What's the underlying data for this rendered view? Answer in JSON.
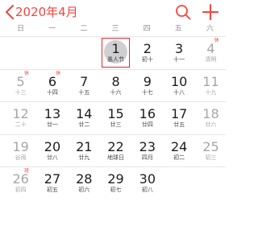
{
  "header": {
    "back_label": "2020年4月",
    "accent_color": "#f2453d",
    "icons": [
      "chevron-left-icon",
      "search-icon",
      "plus-icon"
    ]
  },
  "weekdays": [
    "日",
    "一",
    "二",
    "三",
    "四",
    "五",
    "六"
  ],
  "weeks": [
    [
      {
        "day": "",
        "sub": ""
      },
      {
        "day": "",
        "sub": ""
      },
      {
        "day": "",
        "sub": ""
      },
      {
        "day": "1",
        "sub": "愚人节",
        "today": true
      },
      {
        "day": "2",
        "sub": "初十"
      },
      {
        "day": "3",
        "sub": "十一"
      },
      {
        "day": "4",
        "sub": "清明",
        "badge": "休"
      }
    ],
    [
      {
        "day": "5",
        "sub": "十三",
        "badge": "休"
      },
      {
        "day": "6",
        "sub": "十四",
        "badge": "休"
      },
      {
        "day": "7",
        "sub": "十五"
      },
      {
        "day": "8",
        "sub": "十六"
      },
      {
        "day": "9",
        "sub": "十七"
      },
      {
        "day": "10",
        "sub": "十八"
      },
      {
        "day": "11",
        "sub": "十九"
      }
    ],
    [
      {
        "day": "12",
        "sub": "二十"
      },
      {
        "day": "13",
        "sub": "廿一"
      },
      {
        "day": "14",
        "sub": "廿二"
      },
      {
        "day": "15",
        "sub": "廿三"
      },
      {
        "day": "16",
        "sub": "廿四"
      },
      {
        "day": "17",
        "sub": "廿五"
      },
      {
        "day": "18",
        "sub": "廿六"
      }
    ],
    [
      {
        "day": "19",
        "sub": "谷雨"
      },
      {
        "day": "20",
        "sub": "廿八"
      },
      {
        "day": "21",
        "sub": "廿九"
      },
      {
        "day": "22",
        "sub": "地球日"
      },
      {
        "day": "23",
        "sub": "四月"
      },
      {
        "day": "24",
        "sub": "初二"
      },
      {
        "day": "25",
        "sub": "初三"
      }
    ],
    [
      {
        "day": "26",
        "sub": "初四",
        "badge": "班"
      },
      {
        "day": "27",
        "sub": "初五"
      },
      {
        "day": "28",
        "sub": "初六"
      },
      {
        "day": "29",
        "sub": "初七"
      },
      {
        "day": "30",
        "sub": "初八"
      },
      {
        "day": "",
        "sub": ""
      },
      {
        "day": "",
        "sub": ""
      }
    ]
  ]
}
